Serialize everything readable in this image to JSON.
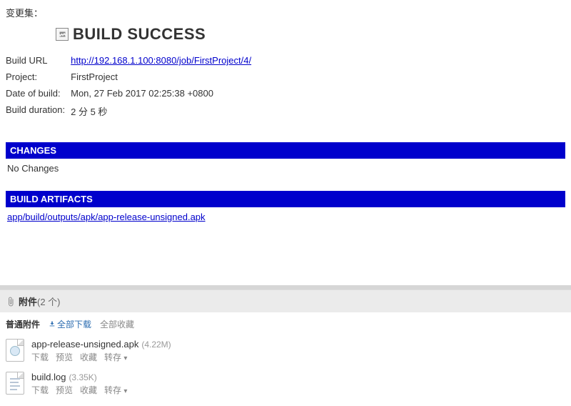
{
  "changeset_label": "变更集：",
  "status": {
    "text": "BUILD SUCCESS",
    "icon": "broken-image-icon"
  },
  "info": {
    "build_url_label": "Build URL",
    "build_url": "http://192.168.1.100:8080/job/FirstProject/4/",
    "project_label": "Project:",
    "project": "FirstProject",
    "date_label": "Date of build:",
    "date": "Mon, 27 Feb 2017 02:25:38 +0800",
    "duration_label": "Build duration:",
    "duration": "2 分 5 秒"
  },
  "changes": {
    "header": "CHANGES",
    "body": "No Changes"
  },
  "artifacts": {
    "header": "BUILD ARTIFACTS",
    "items": [
      "app/build/outputs/apk/app-release-unsigned.apk"
    ]
  },
  "attachments": {
    "title": "附件",
    "count_text": "(2 个)",
    "toolbar": {
      "label": "普通附件",
      "download_all": "全部下载",
      "favorite_all": "全部收藏"
    },
    "action_labels": {
      "download": "下载",
      "preview": "预览",
      "favorite": "收藏",
      "transfer": "转存"
    },
    "files": [
      {
        "name": "app-release-unsigned.apk",
        "size": "(4.22M)",
        "type": "apk"
      },
      {
        "name": "build.log",
        "size": "(3.35K)",
        "type": "log"
      }
    ]
  }
}
